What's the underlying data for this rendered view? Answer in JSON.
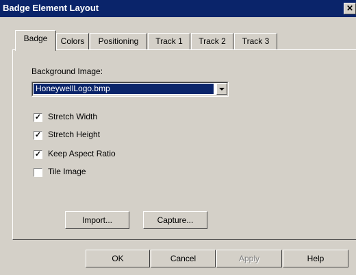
{
  "window": {
    "title": "Badge Element Layout",
    "close_glyph": "✕"
  },
  "tabs": [
    {
      "label": "Badge",
      "active": true
    },
    {
      "label": "Colors",
      "active": false
    },
    {
      "label": "Positioning",
      "active": false
    },
    {
      "label": "Track 1",
      "active": false
    },
    {
      "label": "Track 2",
      "active": false
    },
    {
      "label": "Track 3",
      "active": false
    }
  ],
  "badge": {
    "background_label": "Background Image:",
    "background_value": "HoneywellLogo.bmp",
    "options": [
      {
        "label": "Stretch Width",
        "checked": true,
        "mark": "✓"
      },
      {
        "label": "Stretch Height",
        "checked": true,
        "mark": "✓"
      },
      {
        "label": "Keep Aspect Ratio",
        "checked": true,
        "mark": "✓"
      },
      {
        "label": "Tile Image",
        "checked": false,
        "mark": ""
      }
    ],
    "import_label": "Import...",
    "capture_label": "Capture..."
  },
  "footer": {
    "ok_label": "OK",
    "cancel_label": "Cancel",
    "apply_label": "Apply",
    "help_label": "Help"
  }
}
